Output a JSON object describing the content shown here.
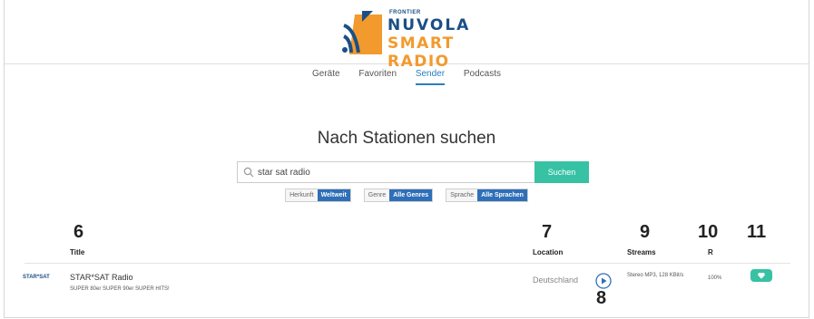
{
  "logo": {
    "brand_small": "FRONTIER",
    "line1": "NUVOLA",
    "line2": "SMART RADIO"
  },
  "nav": {
    "items": [
      "Geräte",
      "Favoriten",
      "Sender",
      "Podcasts"
    ],
    "active": "Sender"
  },
  "heading": "Nach Stationen suchen",
  "search": {
    "value": "star sat radio",
    "button": "Suchen"
  },
  "filters": [
    {
      "label": "Herkunft",
      "value": "Weltweit"
    },
    {
      "label": "Genre",
      "value": "Alle Genres"
    },
    {
      "label": "Sprache",
      "value": "Alle Sprachen"
    }
  ],
  "steps": {
    "title": "6",
    "location": "7",
    "play": "8",
    "streams": "9",
    "rating": "10",
    "favorite": "11"
  },
  "columns": {
    "title": "Title",
    "location": "Location",
    "streams": "Streams",
    "rating": "R"
  },
  "stations": [
    {
      "logo_text": "STAR*SAT",
      "name": "STAR*SAT Radio",
      "subtitle": "SUPER 80er SUPER 90er SUPER HITS!",
      "location": "Deutschland",
      "stream": "Stereo MP3, 128 KBit/s",
      "rating": "100%"
    }
  ],
  "colors": {
    "accent": "#36c2a3",
    "blue": "#2f6fb8",
    "nav_active": "#2a7fbf",
    "orange": "#f29a2e"
  }
}
